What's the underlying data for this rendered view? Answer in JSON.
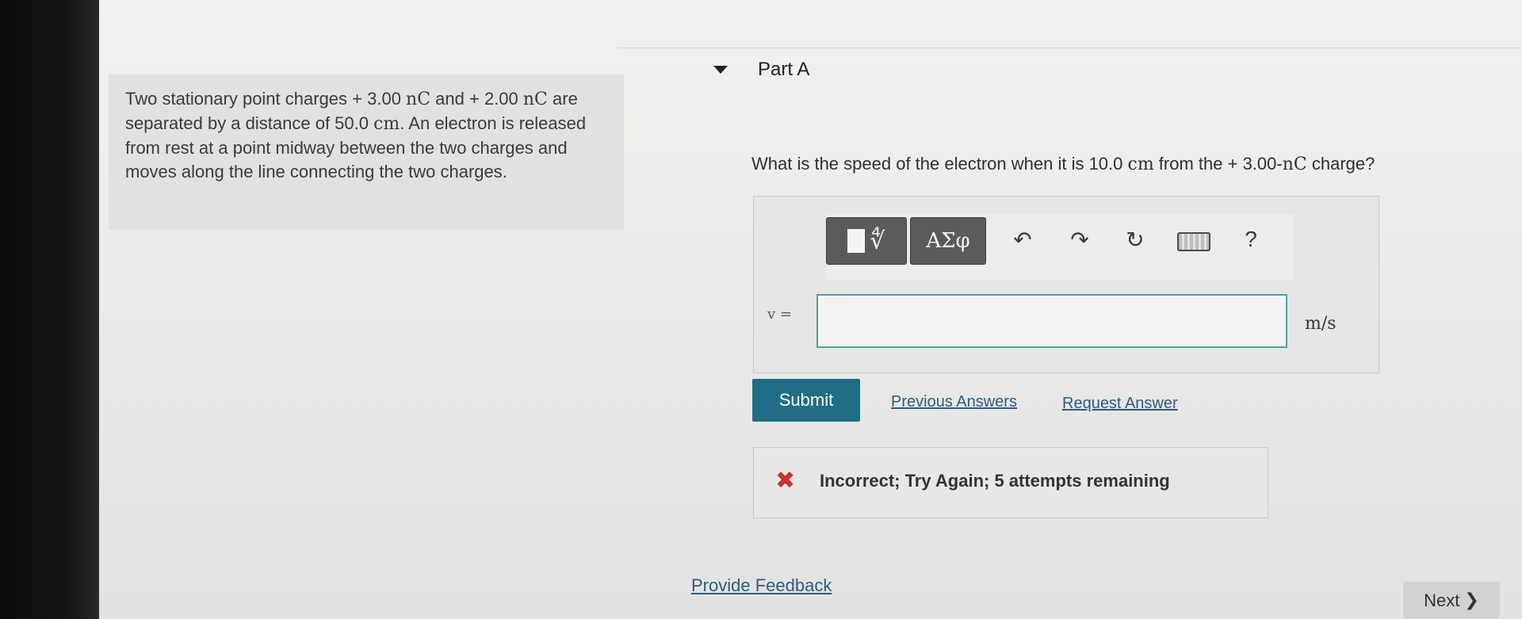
{
  "problem": {
    "parts": [
      "Two stationary point charges + 3.00 ",
      "nC",
      " and + 2.00 ",
      "nC",
      " are separated by a distance of 50.0 ",
      "cm",
      ". An electron is released from rest at a point midway between the two charges and moves along the line connecting the two charges."
    ]
  },
  "part": {
    "title": "Part A",
    "question": {
      "pre": "What is the speed of the electron when it is 10.0 ",
      "unit_cm": "cm",
      "mid": " from the + 3.00-",
      "unit_nc": "nC",
      "post": " charge?"
    }
  },
  "toolbar": {
    "templates_icon": "∜",
    "symbols_label": "ΑΣφ",
    "undo_icon": "↶",
    "redo_icon": "↷",
    "reset_icon": "↻",
    "keyboard_icon": "keyboard-icon",
    "help_label": "?"
  },
  "answer": {
    "variable": "v =",
    "value": "",
    "unit": "m/s"
  },
  "actions": {
    "submit": "Submit",
    "previous_answers": "Previous Answers",
    "request_answer": "Request Answer"
  },
  "feedback": {
    "icon": "✖",
    "message": "Incorrect; Try Again; 5 attempts remaining",
    "icon_color": "#c7322b"
  },
  "footer": {
    "provide_feedback": "Provide Feedback",
    "next": "Next",
    "next_icon": "❯"
  }
}
